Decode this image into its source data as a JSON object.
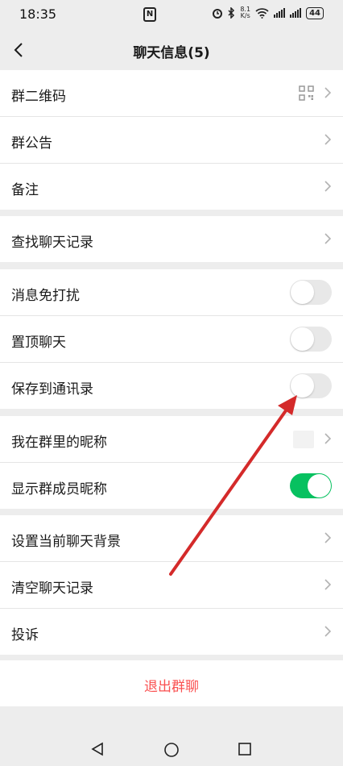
{
  "status": {
    "time": "18:35",
    "speed_top": "8.1",
    "speed_bottom": "K/s",
    "battery": "44"
  },
  "header": {
    "title": "聊天信息(5)"
  },
  "group1": [
    {
      "label": "群二维码"
    },
    {
      "label": "群公告"
    },
    {
      "label": "备注"
    }
  ],
  "group2": [
    {
      "label": "查找聊天记录"
    }
  ],
  "group3": [
    {
      "label": "消息免打扰",
      "toggle": false
    },
    {
      "label": "置顶聊天",
      "toggle": false
    },
    {
      "label": "保存到通讯录",
      "toggle": false
    }
  ],
  "group4": [
    {
      "label": "我在群里的昵称"
    },
    {
      "label": "显示群成员昵称",
      "toggle": true
    }
  ],
  "group5": [
    {
      "label": "设置当前聊天背景"
    },
    {
      "label": "清空聊天记录"
    },
    {
      "label": "投诉"
    }
  ],
  "exit_label": "退出群聊",
  "colors": {
    "accent_green": "#07c160",
    "danger_red": "#fa5151",
    "annotation_arrow": "#d42a2a"
  }
}
